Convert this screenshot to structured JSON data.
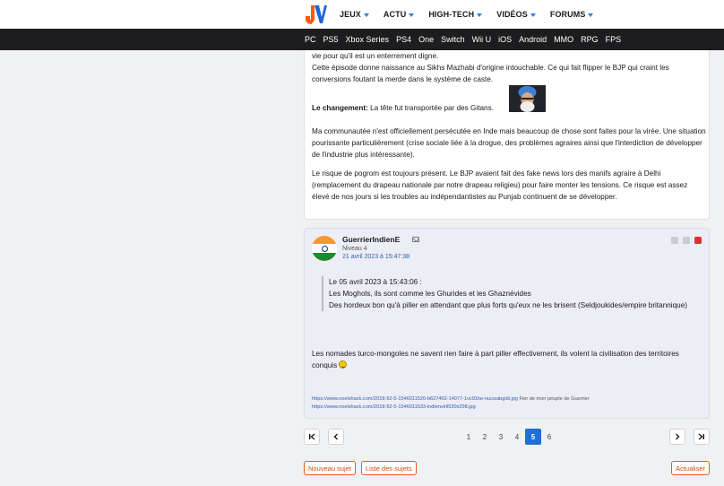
{
  "header": {
    "logo_text": "JV",
    "nav": [
      {
        "label": "JEUX"
      },
      {
        "label": "ACTU"
      },
      {
        "label": "HIGH-TECH"
      },
      {
        "label": "VIDÉOS"
      },
      {
        "label": "FORUMS"
      }
    ],
    "subnav": [
      "PC",
      "PS5",
      "Xbox Series",
      "PS4",
      "One",
      "Switch",
      "Wii U",
      "iOS",
      "Android",
      "MMO",
      "RPG",
      "FPS"
    ]
  },
  "post1": {
    "line1": "vie pour qu'il est un enterrement digne.",
    "line2": "Cette épisode donne naissance au Sikhs Mazhabi d'origine intouchable. Ce qui fait flipper le BJP qui craint les conversions foutant la merde dans le système de caste.",
    "change_label": "Le changement:",
    "change_text": " La tête fut transportée par des Gitans.",
    "para3": "Ma communautée n'est officiellement persécutée en Inde mais beaucoup de chose sont faites pour la virée. Une situation pourissante particulièrement (crise sociale liée à la drogue, des problèmes agraires ainsi que l'interdiction de développer de l'industrie plus intéressante).",
    "para4": "Le risque de pogrom est toujours présent. Le BJP avaient fait des fake news lors des manifs agraire à Delhi (remplacement du drapeau nationale par notre drapeau religieu) pour faire monter les tensions. Ce risque est assez élevé de nos jours si les troubles au indépendantistes au Punjab continuent de se développer."
  },
  "post2": {
    "author": "GuerrierIndienE",
    "level": "Niveau 4",
    "date": "21 avril 2023 à 15:47:38",
    "quote_header": "Le 05 avril 2023 à 15:43:06 :",
    "quote_line1": "Les Moghols, ils sont comme les Ghurides et les Ghaznévides",
    "quote_line2": "Des hordeux bon qu'à piller en attendant que plus forts qu'eux ne les brisent (Seldjoukides/empire britannique)",
    "reply": "Les nomades turco-mongoles ne savent rien faire à part piller effectivement, ils volent la civilisation des territoires conquis",
    "sig_link1": "https://www.noelshack.com/2018-52-5-1546011526-b627462-14077-1vc91he-nucwabgidi.jpg",
    "sig_text1": " Fier de mon peuple de Guerrier",
    "sig_link2": "https://www.noelshack.com/2018-52-5-1546011533-indienviril530x298.jpg"
  },
  "pagination": {
    "first": "⏮",
    "prev": "‹",
    "next": "›",
    "last": "⏭",
    "pages": [
      "1",
      "2",
      "3",
      "4",
      "5",
      "6"
    ],
    "current": "5"
  },
  "actions": {
    "new_topic": "Nouveau sujet",
    "topic_list": "Liste des sujets",
    "refresh": "Actualiser"
  },
  "colors": {
    "accent": "#2b7de9",
    "action": "#e55b1a",
    "current_page": "#1f6fd6"
  }
}
